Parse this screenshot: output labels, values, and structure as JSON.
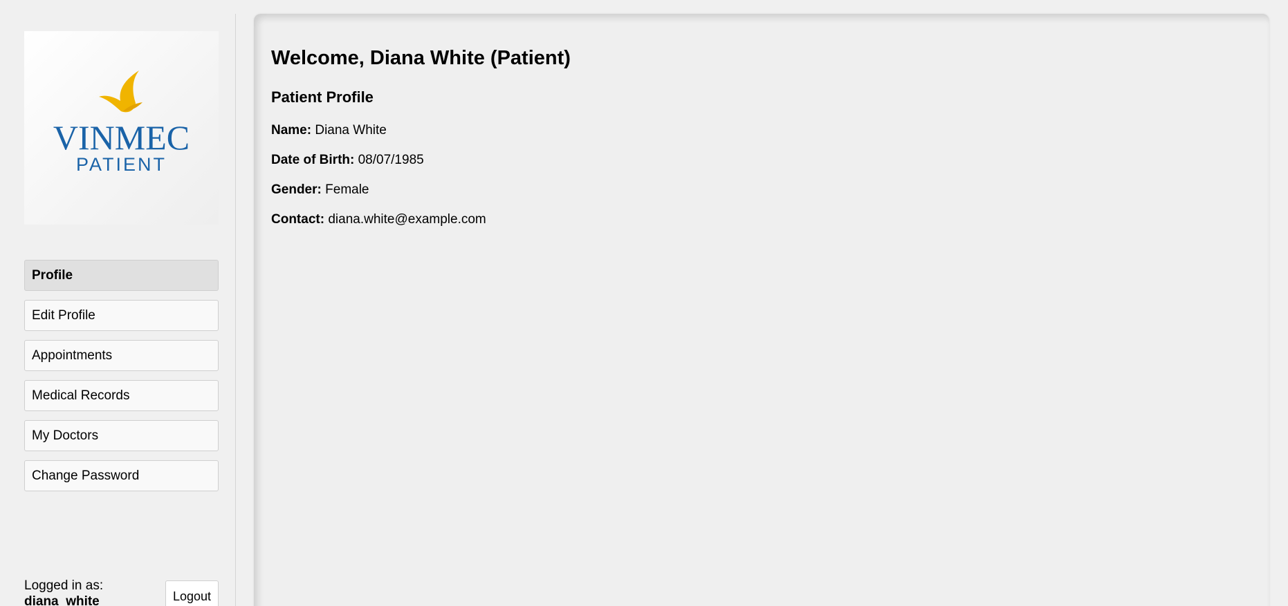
{
  "sidebar": {
    "logo": {
      "brand": "VINMEC",
      "subtitle": "PATIENT",
      "colors": {
        "flame": "#f0b400",
        "text": "#1a63a8"
      }
    },
    "nav": [
      {
        "label": "Profile",
        "active": true
      },
      {
        "label": "Edit Profile"
      },
      {
        "label": "Appointments"
      },
      {
        "label": "Medical Records"
      },
      {
        "label": "My Doctors"
      },
      {
        "label": "Change Password"
      }
    ],
    "status": {
      "logged_in_label": "Logged in as:",
      "username": "diana_white",
      "logout_label": "Logout"
    }
  },
  "main": {
    "welcome": "Welcome, Diana White (Patient)",
    "section_title": "Patient Profile",
    "fields": [
      {
        "label": "Name:",
        "value": "Diana White"
      },
      {
        "label": "Date of Birth:",
        "value": "08/07/1985"
      },
      {
        "label": "Gender:",
        "value": "Female"
      },
      {
        "label": "Contact:",
        "value": "diana.white@example.com"
      }
    ]
  }
}
